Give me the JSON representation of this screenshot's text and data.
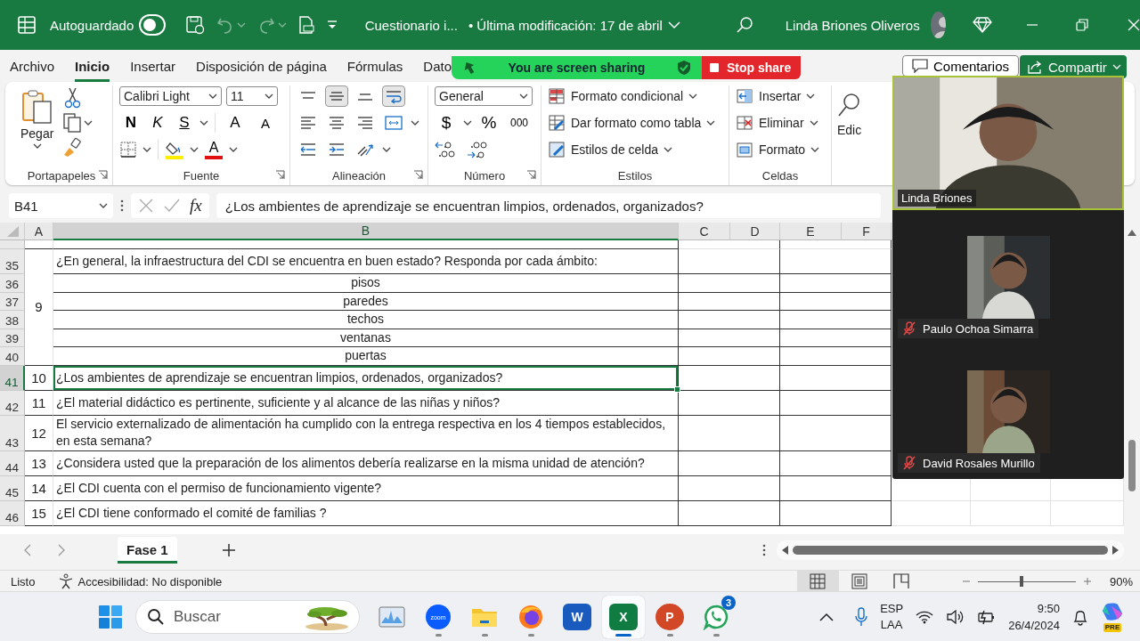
{
  "title_bar": {
    "autosave_label": "Autoguardado",
    "autosave_on": false,
    "quick_access": [
      {
        "kind": "save",
        "disabled": false
      },
      {
        "kind": "undo",
        "disabled": true
      },
      {
        "kind": "redo",
        "disabled": true
      },
      {
        "kind": "print",
        "disabled": false
      },
      {
        "kind": "customize",
        "disabled": false
      }
    ],
    "file_name": "Cuestionario i...",
    "modified": "• Última modificación: 17 de abril",
    "user_name": "Linda Briones Oliveros"
  },
  "ribbon_tabs": [
    {
      "label": "Archivo",
      "selected": false
    },
    {
      "label": "Inicio",
      "selected": true
    },
    {
      "label": "Insertar",
      "selected": false
    },
    {
      "label": "Disposición de página",
      "selected": false
    },
    {
      "label": "Fórmulas",
      "selected": false
    },
    {
      "label": "Dato",
      "selected": false
    }
  ],
  "screen_share": {
    "status": "You are screen sharing",
    "stop_label": "Stop share"
  },
  "comments_button": "Comentarios",
  "share_button": "Compartir",
  "ribbon": {
    "clipboard": {
      "paste": "Pegar",
      "label": "Portapapeles"
    },
    "font": {
      "family": "Calibri Light",
      "size": "11",
      "bold": "N",
      "italic": "K",
      "underline": "S",
      "grow": "A",
      "shrink": "A",
      "font_color_letter": "A",
      "label": "Fuente"
    },
    "alignment": {
      "rows": [
        {
          "buttons": [
            {
              "kind": "top",
              "selected": false
            },
            {
              "kind": "middle",
              "selected": true
            },
            {
              "kind": "bottom",
              "selected": false
            },
            {
              "kind": "wrap",
              "selected": true
            }
          ]
        },
        {
          "buttons": [
            {
              "kind": "left",
              "selected": false
            },
            {
              "kind": "center",
              "selected": false
            },
            {
              "kind": "right",
              "selected": false
            },
            {
              "kind": "merge",
              "selected": false
            }
          ]
        },
        {
          "buttons": [
            {
              "kind": "outdent",
              "selected": false
            },
            {
              "kind": "indent",
              "selected": false
            },
            {
              "kind": "orientation",
              "selected": false
            }
          ]
        }
      ],
      "label": "Alineación"
    },
    "number": {
      "format": "General",
      "currency": "$",
      "percent": "%",
      "thousands": "000",
      "label": "Número"
    },
    "styles": {
      "items": [
        {
          "kind": "conditional",
          "label": "Formato condicional"
        },
        {
          "kind": "table",
          "label": "Dar formato como tabla"
        },
        {
          "kind": "cell_styles",
          "label": "Estilos de celda"
        }
      ],
      "label": "Estilos"
    },
    "cells": {
      "items": [
        {
          "kind": "insert",
          "label": "Insertar"
        },
        {
          "kind": "delete",
          "label": "Eliminar"
        },
        {
          "kind": "format",
          "label": "Formato"
        }
      ],
      "label": "Celdas"
    },
    "editing": {
      "label": "Edic"
    }
  },
  "formula_bar": {
    "name_box": "B41",
    "function_label": "fx",
    "formula": "¿Los ambientes de aprendizaje se encuentran limpios, ordenados, organizados?"
  },
  "columns": [
    {
      "label": "A",
      "selected": false
    },
    {
      "label": "B",
      "selected": true
    },
    {
      "label": "C",
      "selected": false
    },
    {
      "label": "D",
      "selected": false
    },
    {
      "label": "E",
      "selected": false
    },
    {
      "label": "F",
      "selected": false
    }
  ],
  "questions": [
    {
      "number": "9",
      "row": "35",
      "text": "¿En general, la infraestructura del CDI se encuentra en buen estado?  Responda por cada ámbito:",
      "selected": false,
      "items": [
        {
          "row": "36",
          "text": "pisos"
        },
        {
          "row": "37",
          "text": "paredes"
        },
        {
          "row": "38",
          "text": "techos"
        },
        {
          "row": "39",
          "text": "ventanas"
        },
        {
          "row": "40",
          "text": "puertas"
        }
      ]
    },
    {
      "number": "10",
      "row": "41",
      "text": "¿Los ambientes de aprendizaje se encuentran limpios, ordenados, organizados?",
      "selected": true
    },
    {
      "number": "11",
      "row": "42",
      "text": "¿El material didáctico es pertinente, suficiente y al alcance de las niñas y niños?",
      "selected": false
    },
    {
      "number": "12",
      "row": "43",
      "text": "El servicio externalizado de alimentación ha cumplido con la entrega respectiva en los 4 tiempos establecidos, en esta semana?",
      "selected": false
    },
    {
      "number": "13",
      "row": "44",
      "text": "¿Considera usted que la preparación de los alimentos debería realizarse en la misma unidad de atención?",
      "selected": false
    },
    {
      "number": "14",
      "row": "45",
      "text": "¿El CDI cuenta con el permiso de funcionamiento vigente?",
      "selected": false
    },
    {
      "number": "15",
      "row": "46",
      "text": "¿El CDI tiene conformado el comité de familias ?",
      "selected": false
    }
  ],
  "sheet_tabs": [
    {
      "label": "Fase 1",
      "selected": true
    }
  ],
  "status_bar": {
    "status": "Listo",
    "accessibility": "Accesibilidad: No disponible",
    "views": [
      {
        "kind": "normal",
        "selected": true
      },
      {
        "kind": "page_layout",
        "selected": false
      },
      {
        "kind": "page_break",
        "selected": false
      }
    ],
    "zoom": {
      "level": 0.45,
      "reading": "90%"
    }
  },
  "taskbar": {
    "search_placeholder": "Buscar",
    "apps": [
      {
        "kind": "monitor",
        "running": false,
        "active": false
      },
      {
        "kind": "zoom",
        "label": "zoom",
        "running": true,
        "active": false
      },
      {
        "kind": "folder",
        "running": true,
        "active": false
      },
      {
        "kind": "firefox",
        "running": true,
        "active": false
      },
      {
        "kind": "word",
        "letter": "W",
        "running": false,
        "active": false
      },
      {
        "kind": "excel",
        "letter": "X",
        "running": true,
        "active": true
      },
      {
        "kind": "powerpoint",
        "letter": "P",
        "running": true,
        "active": false
      },
      {
        "kind": "whatsapp",
        "badge": "3",
        "running": true,
        "active": false
      }
    ],
    "tray": {
      "language": "ESP",
      "layout": "LAA",
      "time": "9:50",
      "date": "26/4/2024",
      "copilot_badge": "PRE"
    }
  },
  "meeting": {
    "participants": [
      {
        "name": "Linda Briones",
        "kind": "featured",
        "muted": false,
        "speaking": true
      },
      {
        "name": "Paulo Ochoa Simarra",
        "kind": "thumbnail",
        "muted": true,
        "speaking": false
      },
      {
        "name": "David Rosales Murillo",
        "kind": "thumbnail",
        "muted": true,
        "speaking": false
      }
    ]
  }
}
